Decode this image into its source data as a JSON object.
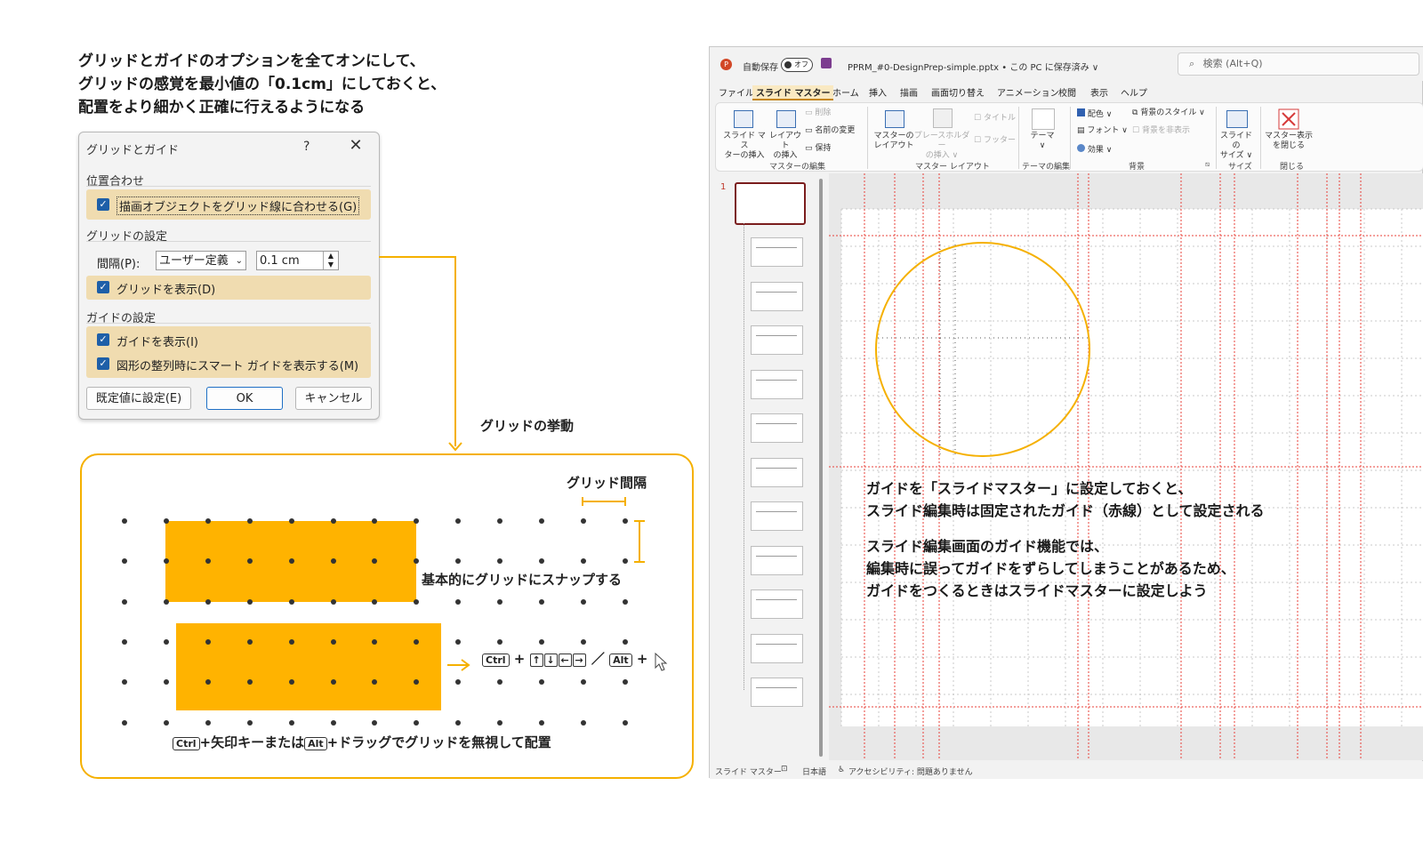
{
  "heading": {
    "line1": "グリッドとガイドのオプションを全てオンにして、",
    "line2": "グリッドの感覚を最小値の「0.1cm」にしておくと、",
    "line3": "配置をより細かく正確に行えるようになる"
  },
  "dialog": {
    "title": "グリッドとガイド",
    "help": "?",
    "close": "✕",
    "snap_section": "位置合わせ",
    "snap_label": "描画オブジェクトをグリッド線に合わせる(G)",
    "grid_section": "グリッドの設定",
    "spacing_label": "間隔(P):",
    "spacing_select": "ユーザー定義",
    "spacing_value": "0.1 cm",
    "show_grid_label": "グリッドを表示(D)",
    "guide_section": "ガイドの設定",
    "show_guides_label": "ガイドを表示(I)",
    "smart_guides_label": "図形の整列時にスマート ガイドを表示する(M)",
    "default_button": "既定値に設定(E)",
    "ok_button": "OK",
    "cancel_button": "キャンセル"
  },
  "grid_behavior": {
    "caption": "グリッドの挙動",
    "spacing_caption": "グリッド間隔",
    "snap_caption": "基本的にグリッドにスナップする",
    "ctrl_key": "Ctrl",
    "alt_key": "Alt",
    "plus": "+",
    "slash": "／",
    "arrow_keys": [
      "↑",
      "↓",
      "←",
      "→"
    ],
    "ignore_caption_mid": "+矢印キーまたは",
    "ignore_caption_end": "+ドラッグでグリッドを無視して配置"
  },
  "ppt": {
    "autosave_label": "自動保存",
    "autosave_state": "オフ",
    "file_name": "PPRM_#0-DesignPrep-simple.pptx • この PC に保存済み ∨",
    "search_placeholder": "検索 (Alt+Q)",
    "menu": [
      "ファイル",
      "スライド マスター",
      "ホーム",
      "挿入",
      "描画",
      "画面切り替え",
      "アニメーション",
      "校閲",
      "表示",
      "ヘルプ"
    ],
    "ribbon": {
      "insert_master": "スライド マス\nターの挿入",
      "insert_layout": "レイアウト\nの挿入",
      "delete": "削除",
      "rename": "名前の変更",
      "preserve": "保持",
      "group_edit_master": "マスターの編集",
      "master_layout": "マスターの\nレイアウト",
      "insert_placeholder": "プレースホルダー\nの挿入 ∨",
      "title_check": "タイトル",
      "footer_check": "フッター",
      "group_master_layout": "マスター レイアウト",
      "themes": "テーマ\n∨",
      "group_edit_theme": "テーマの編集",
      "colors": "配色 ∨",
      "fonts": "フォント ∨",
      "effects": "効果 ∨",
      "bg_styles": "背景のスタイル ∨",
      "hide_bg": "背景を非表示",
      "group_background": "背景",
      "slide_size": "スライドの\nサイズ ∨",
      "group_size": "サイズ",
      "close_master": "マスター表示\nを閉じる",
      "group_close": "閉じる"
    },
    "slide_number": "1",
    "status": {
      "view": "スライド マスター",
      "language": "日本語",
      "accessibility": "アクセシビリティ: 問題ありません"
    }
  },
  "note": {
    "line1": "ガイドを「スライドマスター」に設定しておくと、",
    "line2": "スライド編集時は固定されたガイド（赤線）として設定される",
    "line3": "スライド編集画面のガイド機能では、",
    "line4": "編集時に誤ってガイドをずらしてしまうことがあるため、",
    "line5": "ガイドをつくるときはスライドマスターに設定しよう"
  },
  "colors": {
    "accent_orange": "#f5b000",
    "rect_orange": "#ffb300",
    "guide_red": "#e8403a",
    "checkbox_blue": "#1e5fa8",
    "option_band": "#f0dcb0"
  }
}
